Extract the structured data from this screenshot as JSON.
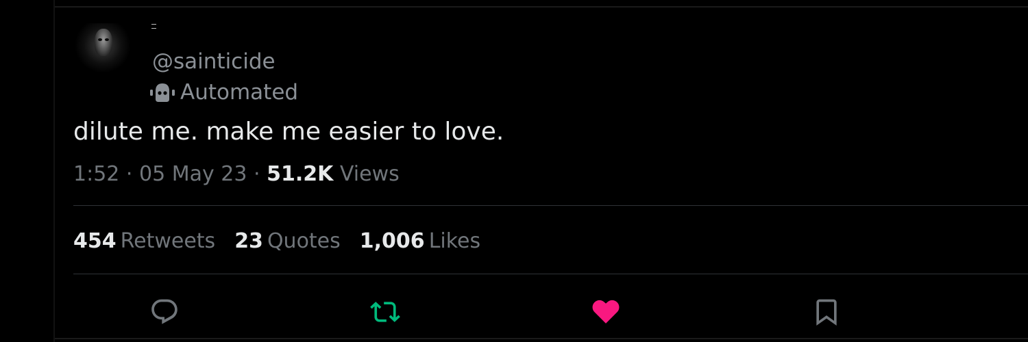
{
  "tweet": {
    "handle": "@sainticide",
    "automated_label": "Automated",
    "text": "dilute me. make me easier to love.",
    "time": "1:52",
    "date": "05 May 23",
    "views_count": "51.2K",
    "views_label": "Views",
    "separator": "·"
  },
  "stats": [
    {
      "count": "454",
      "label": "Retweets"
    },
    {
      "count": "23",
      "label": "Quotes"
    },
    {
      "count": "1,006",
      "label": "Likes"
    }
  ],
  "actions": [
    {
      "icon": "reply-icon",
      "color": "#71767b"
    },
    {
      "icon": "retweet-icon",
      "color": "#00ba7c"
    },
    {
      "icon": "heart-icon",
      "color": "#f91880"
    },
    {
      "icon": "bookmark-icon",
      "color": "#71767b"
    }
  ],
  "colors": {
    "background": "#000000",
    "text_primary": "#e7e9ea",
    "text_secondary": "#71767b",
    "retweet_green": "#00ba7c",
    "like_pink": "#f91880",
    "divider": "#2f3336"
  }
}
